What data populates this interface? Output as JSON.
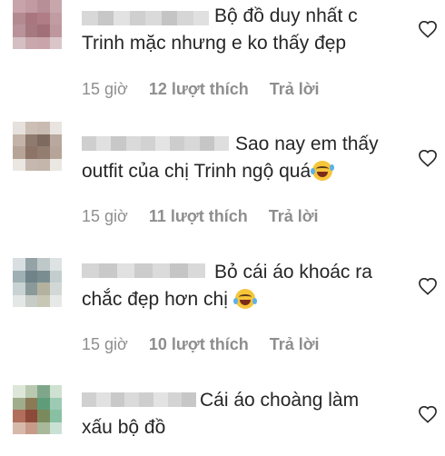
{
  "comments": [
    {
      "lines": [
        "Bộ đồ duy nhất c",
        "Trinh mặc nhưng e ko thấy đẹp"
      ],
      "time": "15 giờ",
      "likes": "12 lượt thích",
      "reply": "Trả lời",
      "emoji": "",
      "avatar_colors": [
        "#c8a3aa",
        "#c29aa1",
        "#b78f96",
        "#c7a6ac",
        "#b48a91",
        "#a9757e",
        "#b07c85",
        "#c29ca3",
        "#b9929a",
        "#a67880",
        "#a16f78",
        "#bd979d",
        "#d5bfc3",
        "#c9a7ad",
        "#c9a5ab",
        "#dac6c9"
      ],
      "username_colors": [
        "#d8d8d8",
        "#c7c7c7",
        "#e2e2e2",
        "#cfcfcf",
        "#dadada",
        "#c4c4c4",
        "#d6d6d6",
        "#e0e0e0"
      ]
    },
    {
      "lines": [
        "Sao nay em thấy",
        "outfit của chị Trinh ngộ quá"
      ],
      "time": "15 giờ",
      "likes": "11 lượt thích",
      "reply": "Trả lời",
      "emoji": "rofl-emoji",
      "avatar_colors": [
        "#e6e1dc",
        "#cbbfb6",
        "#c9bbb2",
        "#e9e4df",
        "#c4b3a8",
        "#8f7a70",
        "#7f6a60",
        "#b8a89d",
        "#b7a498",
        "#8d7466",
        "#937d71",
        "#b6a498",
        "#eae6e2",
        "#c6b8ae",
        "#c4b6ab",
        "#ebe7e3"
      ],
      "username_colors": [
        "#cfcfcf",
        "#e0e0e0",
        "#c8c8c8",
        "#dadada",
        "#d2d2d2",
        "#e4e4e4",
        "#cdcdcd",
        "#d8d8d8",
        "#c6c6c6",
        "#dedede"
      ]
    },
    {
      "lines": [
        "Bỏ cái áo khoác ra",
        "chắc đẹp hơn chị"
      ],
      "time": "15 giờ",
      "likes": "10 lượt thích",
      "reply": "Trả lời",
      "emoji": "laugh-tears-emoji",
      "avatar_colors": [
        "#d9dfe0",
        "#93a3a8",
        "#bfc8c9",
        "#dde2e2",
        "#9eb0b3",
        "#6f8388",
        "#7a8e92",
        "#c3cdce",
        "#c9d2d2",
        "#8a9a9b",
        "#b4b29e",
        "#d2d8d6",
        "#e3e7e6",
        "#c7ccc6",
        "#c8c7b5",
        "#e6e9e8"
      ],
      "username_colors": [
        "#d5d5d5",
        "#c9c9c9",
        "#e1e1e1",
        "#cccccc",
        "#dbdbdb",
        "#c5c5c5",
        "#d9d9d9"
      ]
    },
    {
      "lines": [
        "Cái áo choàng làm",
        "xấu bộ đồ"
      ],
      "time": "",
      "likes": "",
      "reply": "",
      "emoji": "",
      "avatar_colors": [
        "#dde6d8",
        "#b9c9b0",
        "#7fa68a",
        "#cfe1d0",
        "#a0ad8d",
        "#8b7a55",
        "#5f9d7a",
        "#9ccab3",
        "#b06e5b",
        "#8d4a3a",
        "#7b8a5c",
        "#88c0a4",
        "#d7b9ab",
        "#c89a8a",
        "#a8b99a",
        "#c9e1d4"
      ],
      "username_colors": [
        "#d0d0d0",
        "#e1e1e1",
        "#c9c9c9",
        "#dadada",
        "#cecece",
        "#e3e3e3",
        "#d4d4d4",
        "#c7c7c7"
      ]
    }
  ]
}
